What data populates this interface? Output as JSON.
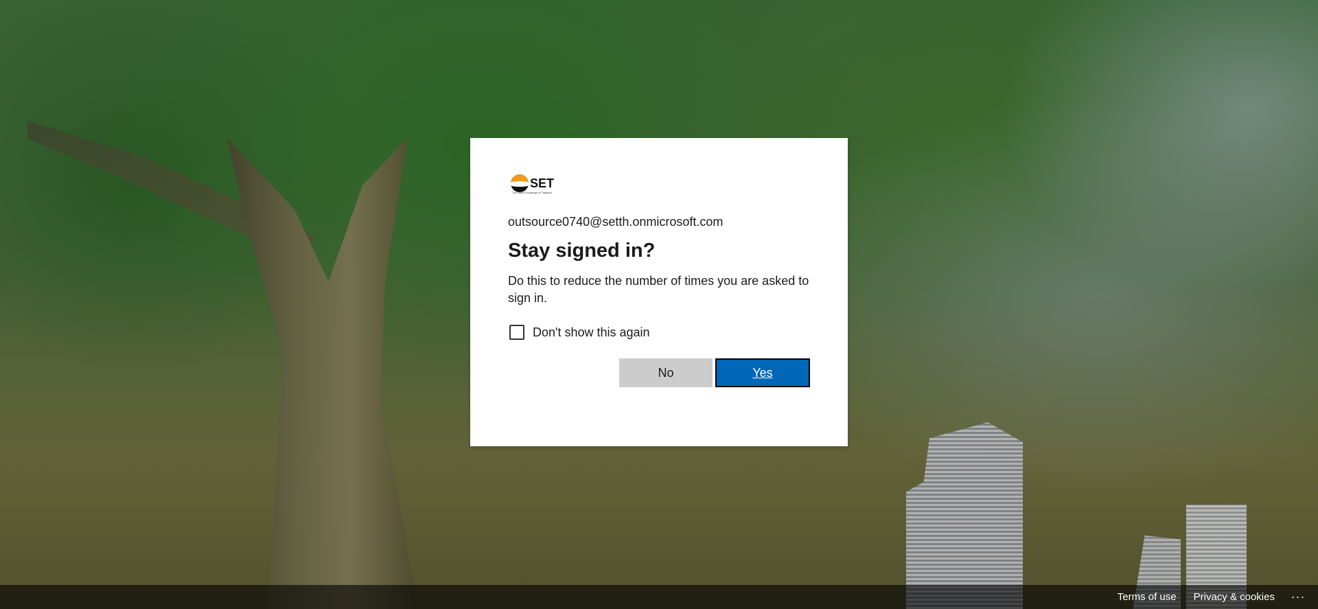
{
  "logo": {
    "text": "SET",
    "subtitle": "The Stock Exchange of Thailand"
  },
  "account": {
    "email": "outsource0740@setth.onmicrosoft.com"
  },
  "dialog": {
    "title": "Stay signed in?",
    "description": "Do this to reduce the number of times you are asked to sign in.",
    "checkbox_label": "Don't show this again",
    "checkbox_checked": false,
    "no_label": "No",
    "yes_label": "Yes"
  },
  "footer": {
    "terms_label": "Terms of use",
    "privacy_label": "Privacy & cookies",
    "more_label": "..."
  },
  "colors": {
    "primary_button": "#0067b8",
    "secondary_button": "#cccccc",
    "dialog_background": "#ffffff",
    "logo_orange": "#f29a1d"
  }
}
